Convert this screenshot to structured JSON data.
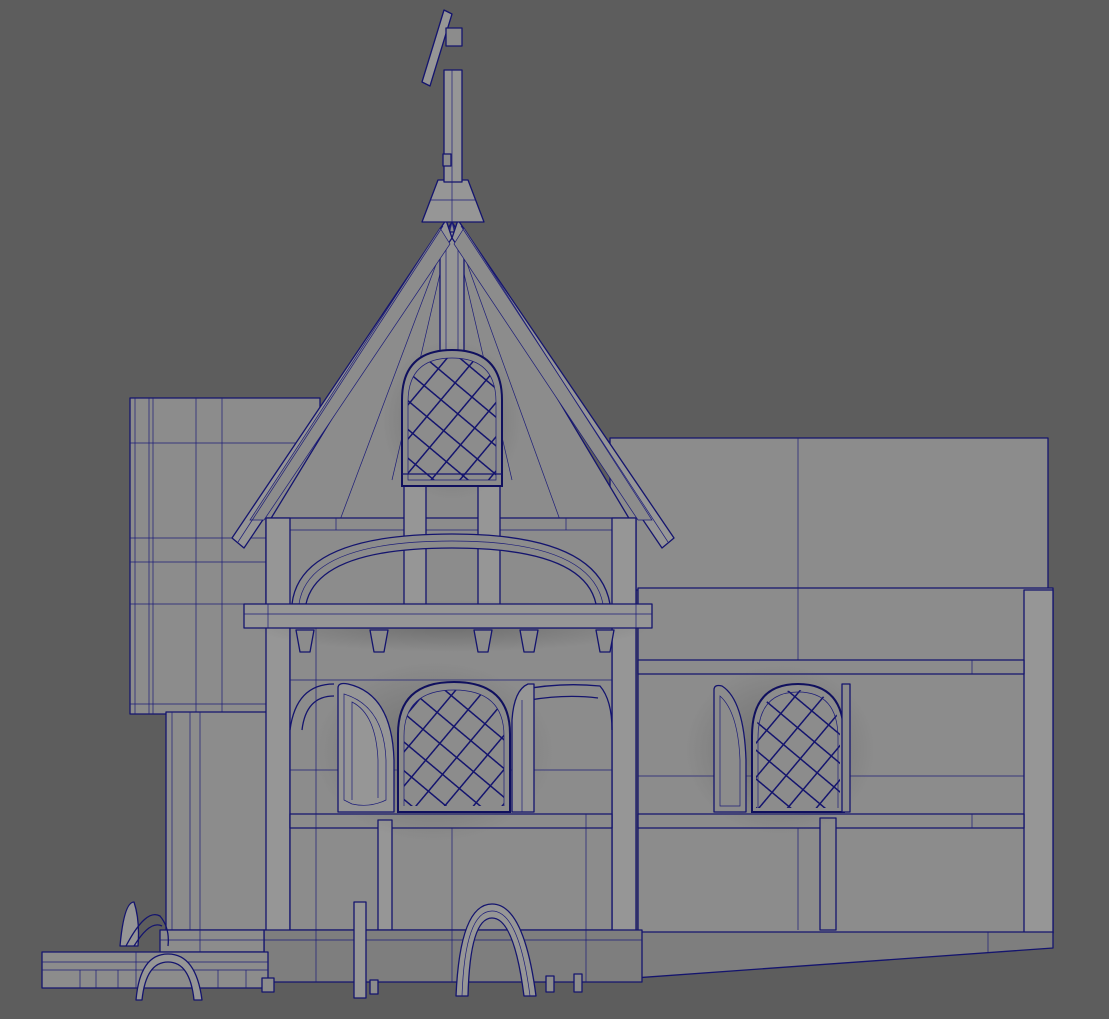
{
  "viewport": {
    "background": "#5d5d5d",
    "mesh_fill": "#888888",
    "wireframe_color": "#14146e",
    "display_mode": "wireframe-on-shaded"
  },
  "model": {
    "subject": "house",
    "parts": [
      "spire-cross-icon",
      "gable-roof",
      "gable-window",
      "balcony-ledge",
      "arched-windows-front",
      "arched-window-side",
      "back-wing-wall",
      "left-annex",
      "foundation-step",
      "front-arch",
      "fence-arches"
    ]
  }
}
